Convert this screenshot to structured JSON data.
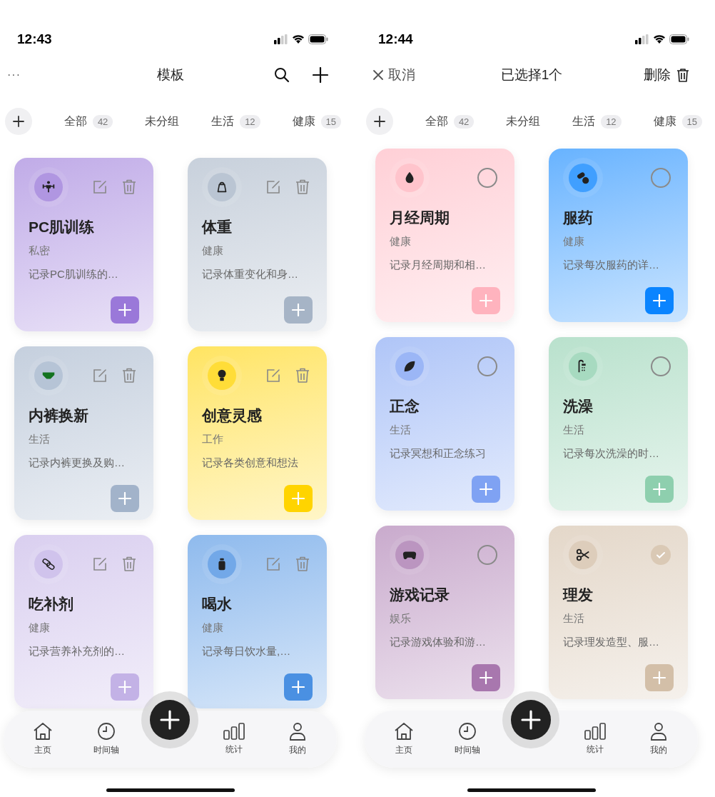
{
  "screens": [
    {
      "time": "12:43",
      "header": {
        "menu": "···",
        "title": "模板"
      },
      "chips": [
        {
          "label": "全部",
          "count": "42"
        },
        {
          "label": "未分组"
        },
        {
          "label": "生活",
          "count": "12"
        },
        {
          "label": "健康",
          "count": "15"
        }
      ],
      "cards": [
        {
          "title": "PC肌训练",
          "category": "私密",
          "desc": "记录PC肌训练的…",
          "color": "#9a78d9"
        },
        {
          "title": "体重",
          "category": "健康",
          "desc": "记录体重变化和身…",
          "color": "#a6b4c6"
        },
        {
          "title": "内裤换新",
          "category": "生活",
          "desc": "记录内裤更换及购…",
          "color": "#a2b3ca"
        },
        {
          "title": "创意灵感",
          "category": "工作",
          "desc": "记录各类创意和想法",
          "color": "#ffd400"
        },
        {
          "title": "吃补剂",
          "category": "健康",
          "desc": "记录营养补充剂的…",
          "color": "#c3b2e6"
        },
        {
          "title": "喝水",
          "category": "健康",
          "desc": "记录每日饮水量,…",
          "color": "#4a90e2"
        }
      ],
      "tabs": [
        {
          "label": "主页"
        },
        {
          "label": "时间轴"
        },
        {
          "label": "统计"
        },
        {
          "label": "我的"
        }
      ]
    },
    {
      "time": "12:44",
      "header": {
        "cancel": "取消",
        "title": "已选择1个",
        "action": "删除"
      },
      "chips": [
        {
          "label": "全部",
          "count": "42"
        },
        {
          "label": "未分组"
        },
        {
          "label": "生活",
          "count": "12"
        },
        {
          "label": "健康",
          "count": "15"
        }
      ],
      "cards": [
        {
          "title": "月经周期",
          "category": "健康",
          "desc": "记录月经周期和相…",
          "color": "#ffb3be",
          "selected": false
        },
        {
          "title": "服药",
          "category": "健康",
          "desc": "记录每次服药的详…",
          "color": "#0a84ff",
          "selected": false
        },
        {
          "title": "正念",
          "category": "生活",
          "desc": "记录冥想和正念练习",
          "color": "#7fa2f3",
          "selected": false
        },
        {
          "title": "洗澡",
          "category": "生活",
          "desc": "记录每次洗澡的时…",
          "color": "#8ecfae",
          "selected": false
        },
        {
          "title": "游戏记录",
          "category": "娱乐",
          "desc": "记录游戏体验和游…",
          "color": "#a877ae",
          "selected": false
        },
        {
          "title": "理发",
          "category": "生活",
          "desc": "记录理发造型、服…",
          "color": "#d3bfa8",
          "selected": true
        }
      ],
      "tabs": [
        {
          "label": "主页"
        },
        {
          "label": "时间轴"
        },
        {
          "label": "统计"
        },
        {
          "label": "我的"
        }
      ]
    }
  ]
}
